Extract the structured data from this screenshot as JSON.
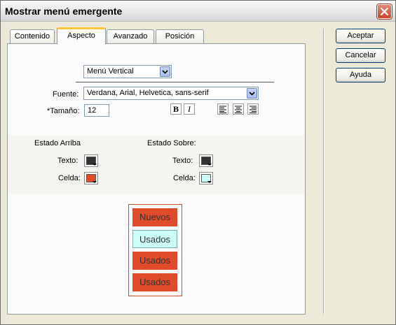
{
  "window": {
    "title": "Mostrar menú emergente"
  },
  "tabs": [
    {
      "label": "Contenido",
      "active": false
    },
    {
      "label": "Aspecto",
      "active": true
    },
    {
      "label": "Avanzado",
      "active": false
    },
    {
      "label": "Posición",
      "active": false
    }
  ],
  "layout_select": {
    "value": "Menú Vertical"
  },
  "font": {
    "label": "Fuente:",
    "value": "Verdana, Arial, Helvetica, sans-serif"
  },
  "size": {
    "label": "*Tamaño:",
    "value": "12"
  },
  "format_buttons": {
    "bold": "B",
    "italic": "I"
  },
  "state_up": {
    "title": "Estado Arriba",
    "text_label": "Texto:",
    "cell_label": "Celda:",
    "text_color": "#333333",
    "cell_color": "#e04b2a"
  },
  "state_over": {
    "title": "Estado Sobre:",
    "text_label": "Texto:",
    "cell_label": "Celda:",
    "text_color": "#333333",
    "cell_color": "#ccfffa"
  },
  "preview": {
    "items": [
      {
        "label": "Nuevos",
        "state": "up"
      },
      {
        "label": "Usados",
        "state": "over"
      },
      {
        "label": "Usados",
        "state": "up"
      },
      {
        "label": "Usados",
        "state": "up"
      }
    ]
  },
  "buttons": {
    "ok": "Aceptar",
    "cancel": "Cancelar",
    "help": "Ayuda"
  },
  "colors": {
    "tab_highlight": "#ffc83c",
    "preview_border": "#cc4d2e"
  }
}
